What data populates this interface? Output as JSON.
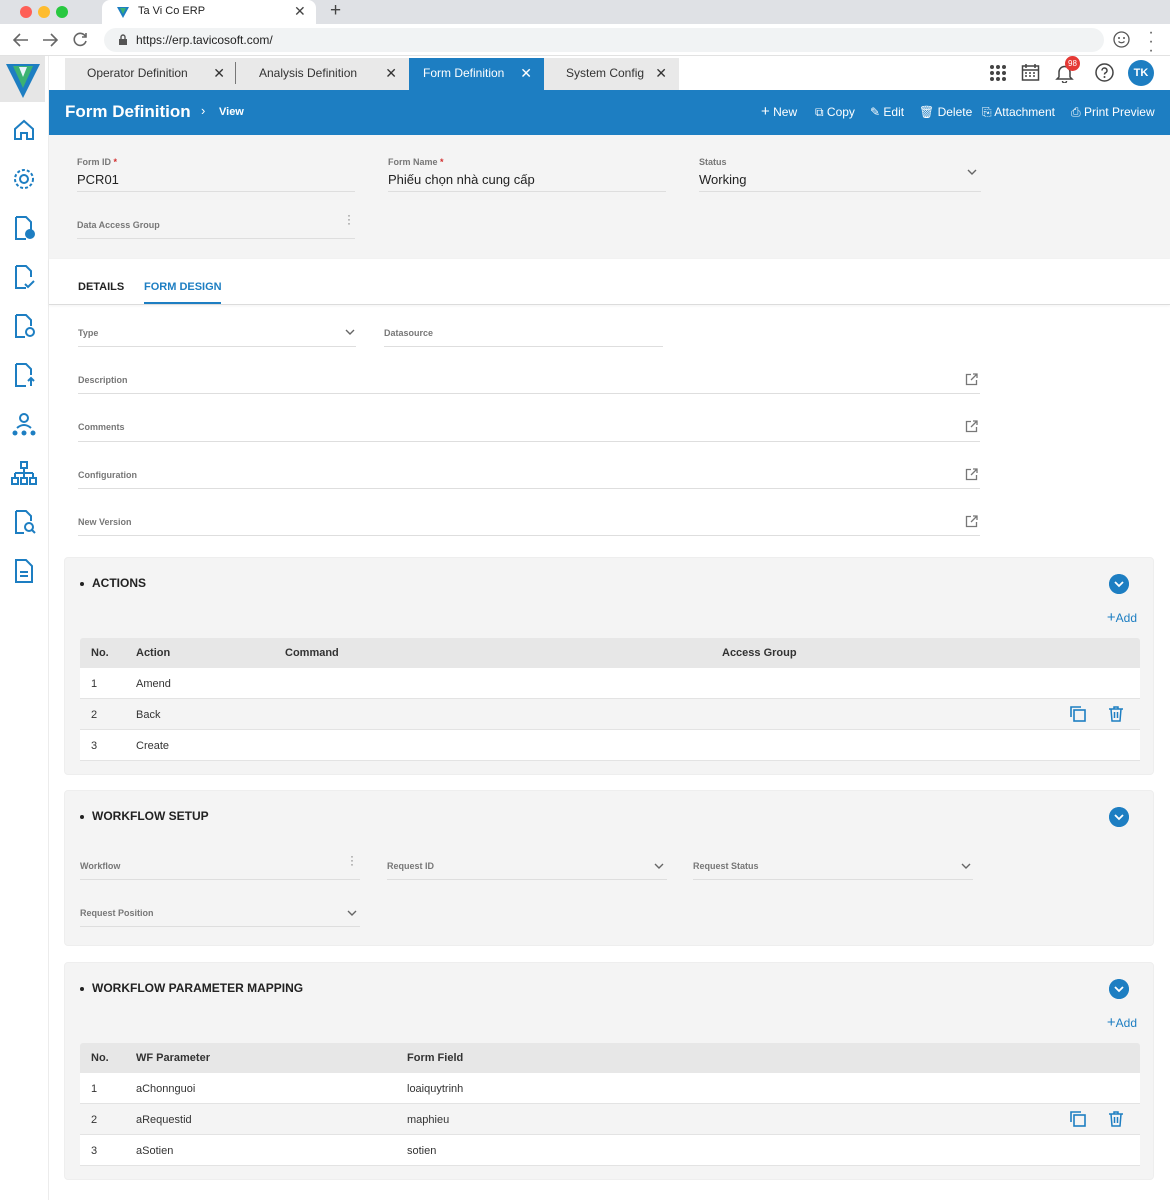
{
  "browser": {
    "tab_title": "Ta Vi Co ERP",
    "url": "https://erp.tavicosoft.com/"
  },
  "app_tabs": [
    {
      "label": "Operator Definition"
    },
    {
      "label": "Analysis Definition"
    },
    {
      "label": "Form Definition"
    },
    {
      "label": "System Config"
    }
  ],
  "topbar": {
    "notification_count": "98",
    "avatar_initials": "TK"
  },
  "header": {
    "title": "Form Definition",
    "breadcrumb": "View",
    "actions": {
      "new": "New",
      "copy": "Copy",
      "edit": "Edit",
      "delete": "Delete",
      "attachment": "Attachment",
      "print_preview": "Print Preview"
    }
  },
  "form": {
    "form_id_label": "Form ID",
    "form_id_value": "PCR01",
    "form_name_label": "Form Name",
    "form_name_value": "Phiếu chọn nhà cung cấp",
    "status_label": "Status",
    "status_value": "Working",
    "data_access_group_label": "Data Access Group",
    "required_mark": "*"
  },
  "detail_tabs": {
    "details": "DETAILS",
    "form_design": "FORM DESIGN"
  },
  "design": {
    "type_label": "Type",
    "datasource_label": "Datasource",
    "description_label": "Description",
    "comments_label": "Comments",
    "configuration_label": "Configuration",
    "new_version_label": "New Version"
  },
  "actions_section": {
    "title": "ACTIONS",
    "add_label": "Add",
    "columns": [
      "No.",
      "Action",
      "Command",
      "Access Group"
    ],
    "rows": [
      {
        "no": "1",
        "action": "Amend",
        "command": "",
        "access_group": ""
      },
      {
        "no": "2",
        "action": "Back",
        "command": "",
        "access_group": ""
      },
      {
        "no": "3",
        "action": "Create",
        "command": "",
        "access_group": ""
      }
    ]
  },
  "workflow_setup": {
    "title": "WORKFLOW SETUP",
    "workflow_label": "Workflow",
    "request_id_label": "Request ID",
    "request_status_label": "Request Status",
    "request_position_label": "Request Position"
  },
  "wf_mapping": {
    "title": "WORKFLOW PARAMETER MAPPING",
    "add_label": "Add",
    "columns": [
      "No.",
      "WF Parameter",
      "Form Field"
    ],
    "rows": [
      {
        "no": "1",
        "wf_parameter": "aChonnguoi",
        "form_field": "loaiquytrinh"
      },
      {
        "no": "2",
        "wf_parameter": "aRequestid",
        "form_field": "maphieu"
      },
      {
        "no": "3",
        "wf_parameter": "aSotien",
        "form_field": "sotien"
      }
    ]
  },
  "colors": {
    "primary": "#1d7ec2",
    "badge": "#e53935"
  }
}
